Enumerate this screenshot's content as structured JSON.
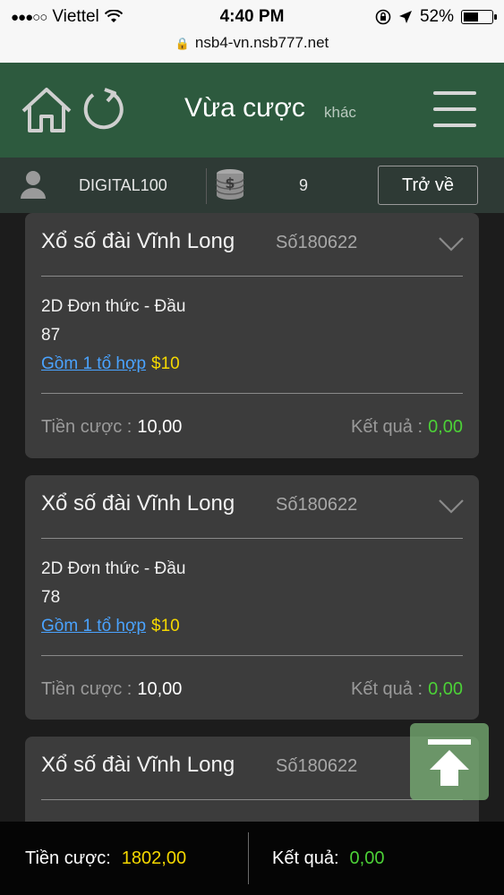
{
  "status_bar": {
    "carrier": "Viettel",
    "signal": "●●●○○",
    "time": "4:40 PM",
    "battery_percent": "52%",
    "battery_level": 0.52,
    "url": "nsb4-vn.nsb777.net"
  },
  "header": {
    "title": "Vừa cược",
    "subtitle": "khác",
    "icons": [
      "home-icon",
      "refresh-icon",
      "menu-icon"
    ]
  },
  "user_bar": {
    "username": "DIGITAL100",
    "balance": "9",
    "back_label": "Trở về",
    "icons": [
      "user-icon",
      "coin-stack-icon"
    ]
  },
  "bets": [
    {
      "title": "Xổ số đài Vĩnh Long",
      "code": "Số180622",
      "bet_type": "2D Đơn thức - Đầu",
      "number": "87",
      "combo_label": "Gồm 1 tổ hợp",
      "combo_amount": "$10",
      "stake_label": "Tiền cược",
      "stake_value": "10,00",
      "result_label": "Kết quả",
      "result_value": "0,00"
    },
    {
      "title": "Xổ số đài Vĩnh Long",
      "code": "Số180622",
      "bet_type": "2D Đơn thức - Đầu",
      "number": "78",
      "combo_label": "Gồm 1 tổ hợp",
      "combo_amount": "$10",
      "stake_label": "Tiền cược",
      "stake_value": "10,00",
      "result_label": "Kết quả",
      "result_value": "0,00"
    },
    {
      "title": "Xổ số đài Vĩnh Long",
      "code": "Số180622"
    }
  ],
  "footer": {
    "stake_label": "Tiền cược:",
    "stake_value": "1802,00",
    "result_label": "Kết quả:",
    "result_value": "0,00"
  },
  "colors": {
    "header_bg": "#2d5a3e",
    "user_bar_bg": "#2e3a35",
    "card_bg": "#3c3c3c",
    "link": "#4aa3ff",
    "amount_yellow": "#f5d800",
    "result_green": "#4cd137",
    "scroll_button": "#7eb87a"
  }
}
